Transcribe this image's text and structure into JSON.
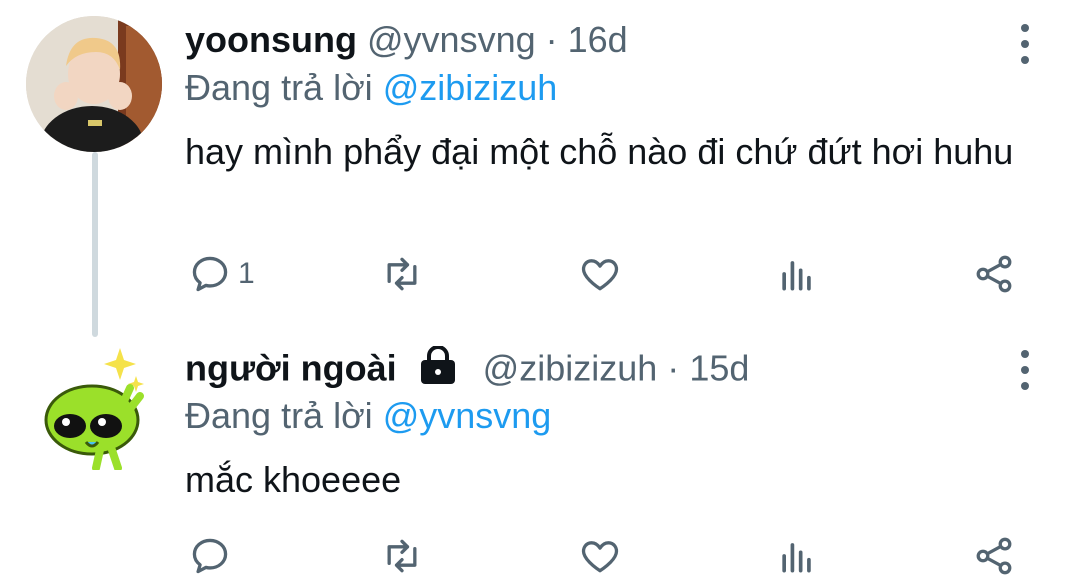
{
  "tweets": [
    {
      "name": "yoonsung",
      "handle": "@yvnsvng",
      "sep": "·",
      "time": "16d",
      "reply_prefix": "Đang trả lời",
      "reply_to": "@zibizizuh",
      "text": "hay mình phẩy đại một chỗ nào đi chứ đứt hơi huhu",
      "reply_count": "1",
      "avatar_icon": "person-photo-avatar"
    },
    {
      "name": "người ngoài",
      "handle": "@zibizizuh",
      "sep": "·",
      "time": "15d",
      "reply_prefix": "Đang trả lời",
      "reply_to": "@yvnsvng",
      "text": "mắc khoeeee",
      "reply_count": "",
      "avatar_icon": "green-alien-avatar",
      "locked": true
    }
  ],
  "colors": {
    "accent": "#1d9bf0",
    "muted": "#536471",
    "text": "#0f1419",
    "line": "#cfd9de"
  }
}
